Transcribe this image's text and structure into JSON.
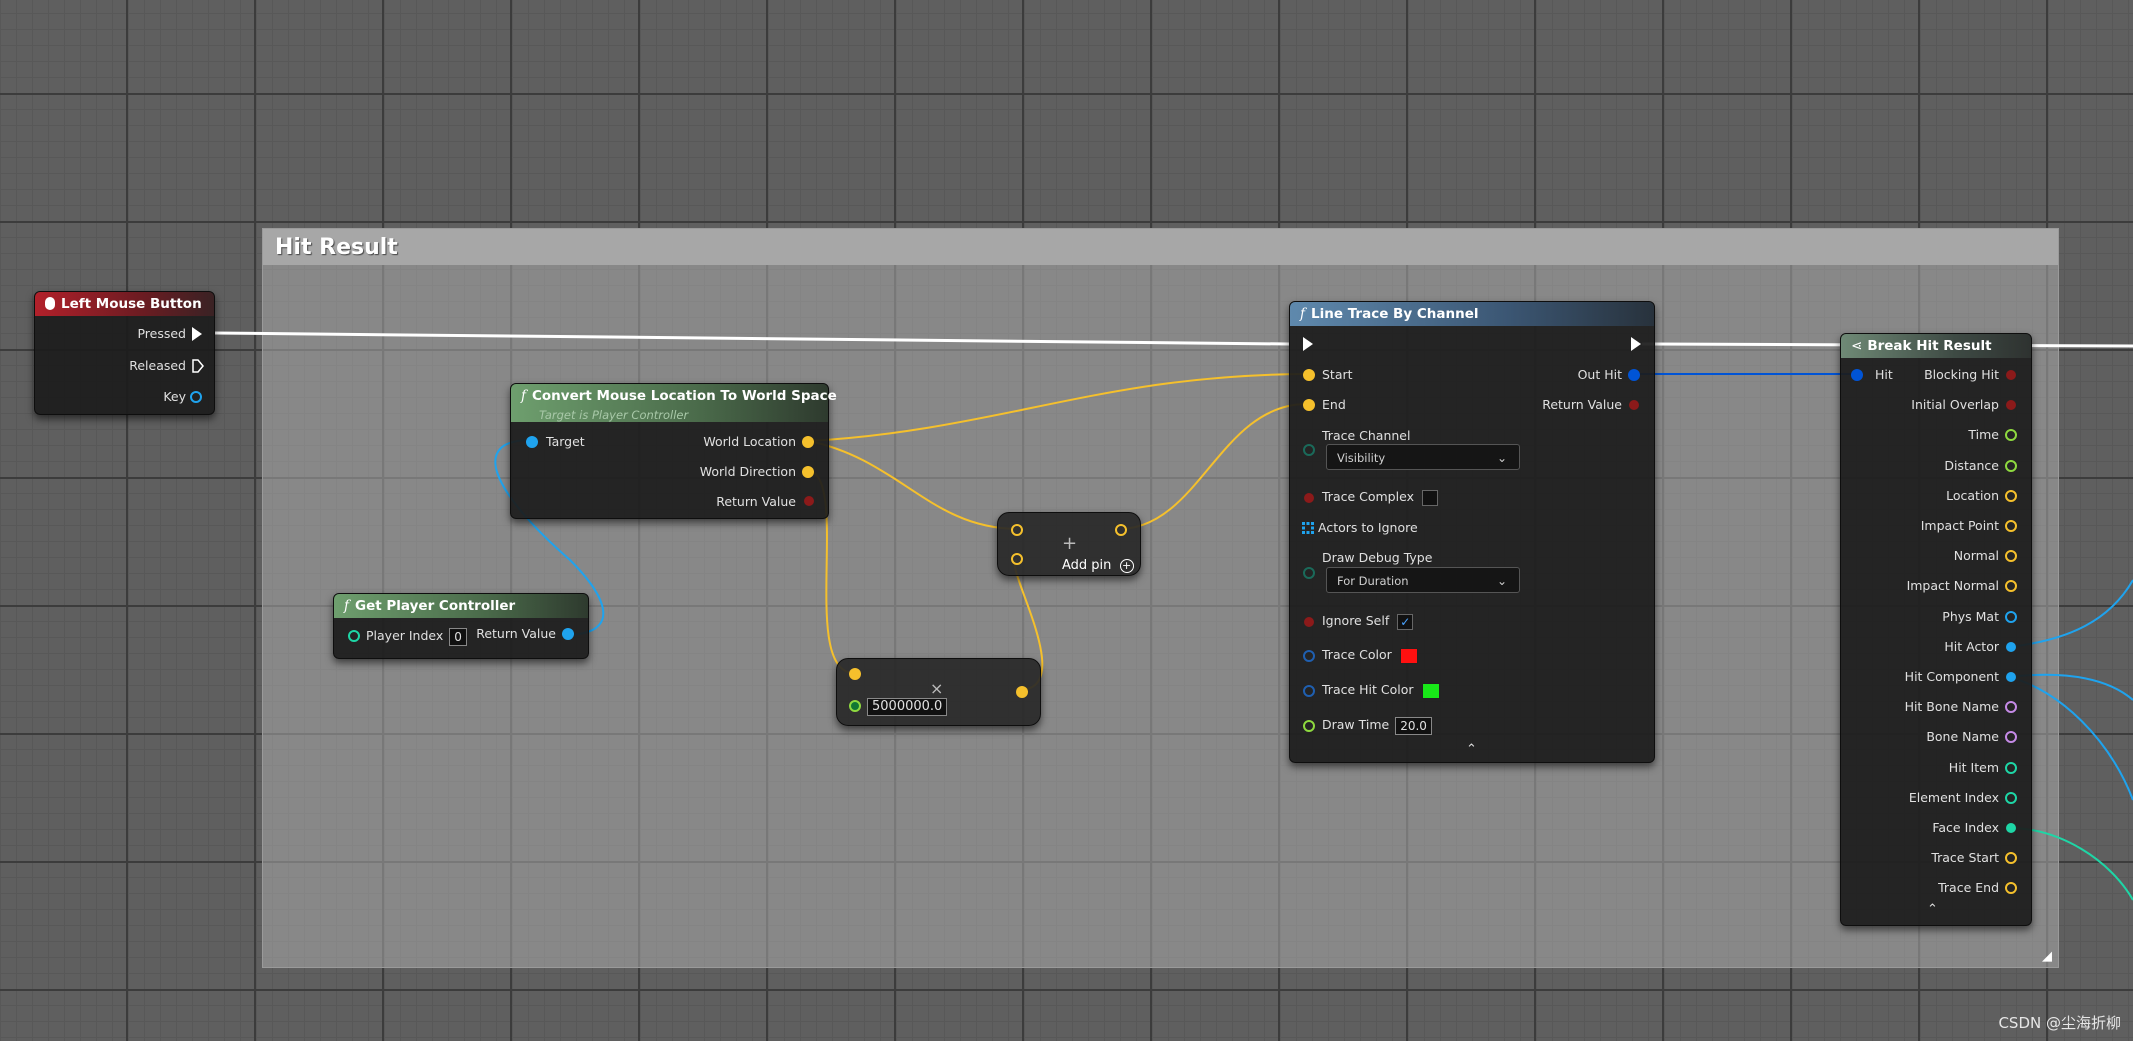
{
  "comment": {
    "title": "Hit Result"
  },
  "nodes": {
    "left_mouse": {
      "title": "Left Mouse Button",
      "pins": [
        "Pressed",
        "Released",
        "Key"
      ]
    },
    "convert": {
      "title": "Convert Mouse Location To World Space",
      "subtitle": "Target is Player Controller",
      "target": "Target",
      "world_location": "World Location",
      "world_direction": "World Direction",
      "return_value": "Return Value"
    },
    "get_pc": {
      "title": "Get Player Controller",
      "player_index": "Player Index",
      "player_index_value": "0",
      "return_value": "Return Value"
    },
    "multiply": {
      "operator": "×",
      "value": "5000000.0"
    },
    "add": {
      "add_pin": "Add pin",
      "operator": "+"
    },
    "line_trace": {
      "title": "Line Trace By Channel",
      "start": "Start",
      "end": "End",
      "out_hit": "Out Hit",
      "return_value": "Return Value",
      "trace_channel": "Trace Channel",
      "trace_channel_value": "Visibility",
      "trace_complex": "Trace Complex",
      "actors_to_ignore": "Actors to Ignore",
      "draw_debug_type": "Draw Debug Type",
      "draw_debug_value": "For Duration",
      "ignore_self": "Ignore Self",
      "trace_color": "Trace Color",
      "trace_hit_color": "Trace Hit Color",
      "draw_time": "Draw Time",
      "draw_time_value": "20.0",
      "trace_color_hex": "#ff1010",
      "trace_hit_color_hex": "#18e818"
    },
    "break_hit": {
      "title": "Break Hit Result",
      "hit": "Hit",
      "outputs": [
        "Blocking Hit",
        "Initial Overlap",
        "Time",
        "Distance",
        "Location",
        "Impact Point",
        "Normal",
        "Impact Normal",
        "Phys Mat",
        "Hit Actor",
        "Hit Component",
        "Hit Bone Name",
        "Bone Name",
        "Hit Item",
        "Element Index",
        "Face Index",
        "Trace Start",
        "Trace End"
      ]
    }
  },
  "pin_colors": {
    "exec": "#ffffff",
    "vector": "#f5c02c",
    "object": "#1fa3ee",
    "bool": "#8c1a1a",
    "float": "#8ed93f",
    "int": "#1ed6a6",
    "name": "#c58ae6",
    "struct": "#0054d6"
  },
  "watermark": "CSDN @尘海折柳"
}
